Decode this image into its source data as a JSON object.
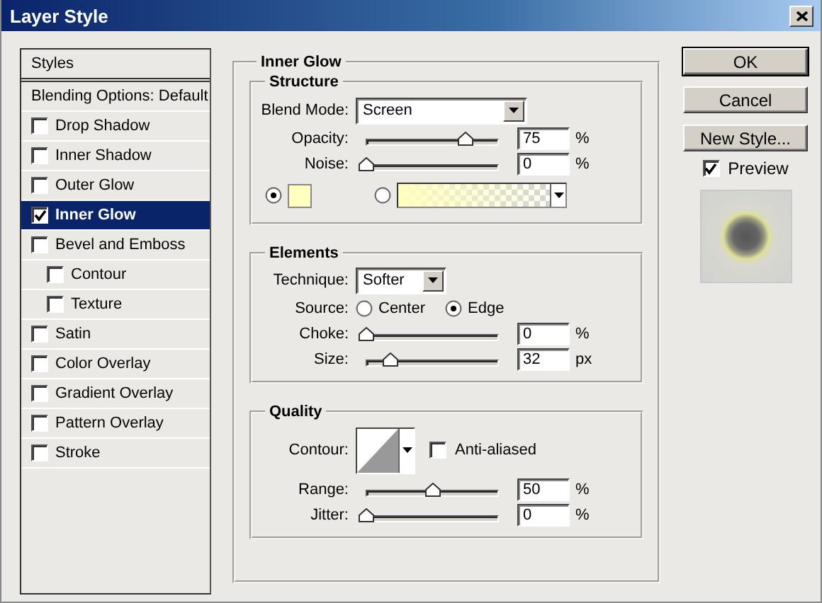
{
  "window": {
    "title": "Layer Style"
  },
  "styles": {
    "items": [
      {
        "kind": "header",
        "label": "Styles",
        "selected": false
      },
      {
        "kind": "plain",
        "label": "Blending Options: Default",
        "selected": false
      },
      {
        "kind": "check",
        "label": "Drop Shadow",
        "checked": false,
        "selected": false
      },
      {
        "kind": "check",
        "label": "Inner Shadow",
        "checked": false,
        "selected": false
      },
      {
        "kind": "check",
        "label": "Outer Glow",
        "checked": false,
        "selected": false
      },
      {
        "kind": "check",
        "label": "Inner Glow",
        "checked": true,
        "selected": true
      },
      {
        "kind": "check",
        "label": "Bevel and Emboss",
        "checked": false,
        "selected": false,
        "children": [
          {
            "kind": "check",
            "label": "Contour",
            "checked": false,
            "selected": false
          },
          {
            "kind": "check",
            "label": "Texture",
            "checked": false,
            "selected": false
          }
        ]
      },
      {
        "kind": "check",
        "label": "Satin",
        "checked": false,
        "selected": false
      },
      {
        "kind": "check",
        "label": "Color Overlay",
        "checked": false,
        "selected": false
      },
      {
        "kind": "check",
        "label": "Gradient Overlay",
        "checked": false,
        "selected": false
      },
      {
        "kind": "check",
        "label": "Pattern Overlay",
        "checked": false,
        "selected": false
      },
      {
        "kind": "check",
        "label": "Stroke",
        "checked": false,
        "selected": false
      }
    ]
  },
  "panel": {
    "title": "Inner Glow",
    "structure": {
      "title": "Structure",
      "blend_mode": {
        "label": "Blend Mode:",
        "value": "Screen"
      },
      "sliders": [
        {
          "label": "Opacity:",
          "level": 0.75,
          "value": "75",
          "unit": "%"
        },
        {
          "label": "Noise:",
          "level": 0,
          "value": "0",
          "unit": "%"
        }
      ],
      "fill_options": [
        {
          "kind": "color",
          "selected": true,
          "color": "#ffffc0"
        },
        {
          "kind": "gradient",
          "selected": false,
          "color": "#ffffc0"
        }
      ]
    },
    "elements": {
      "title": "Elements",
      "technique": {
        "label": "Technique:",
        "value": "Softer"
      },
      "source": {
        "label": "Source:",
        "options": [
          {
            "label": "Center",
            "selected": false
          },
          {
            "label": "Edge",
            "selected": true
          }
        ]
      },
      "sliders": [
        {
          "label": "Choke:",
          "level": 0,
          "value": "0",
          "unit": "%"
        },
        {
          "label": "Size:",
          "level": 0.18,
          "value": "32",
          "unit": "px"
        }
      ]
    },
    "quality": {
      "title": "Quality",
      "contour_label": "Contour:",
      "anti_aliased": {
        "label": "Anti-aliased",
        "checked": false
      },
      "sliders": [
        {
          "label": "Range:",
          "level": 0.5,
          "value": "50",
          "unit": "%"
        },
        {
          "label": "Jitter:",
          "level": 0,
          "value": "0",
          "unit": "%"
        }
      ]
    }
  },
  "buttons": [
    {
      "label": "OK",
      "default": true
    },
    {
      "label": "Cancel",
      "default": false
    },
    {
      "label": "New Style...",
      "default": false
    }
  ],
  "preview": {
    "label": "Preview",
    "checked": true
  }
}
